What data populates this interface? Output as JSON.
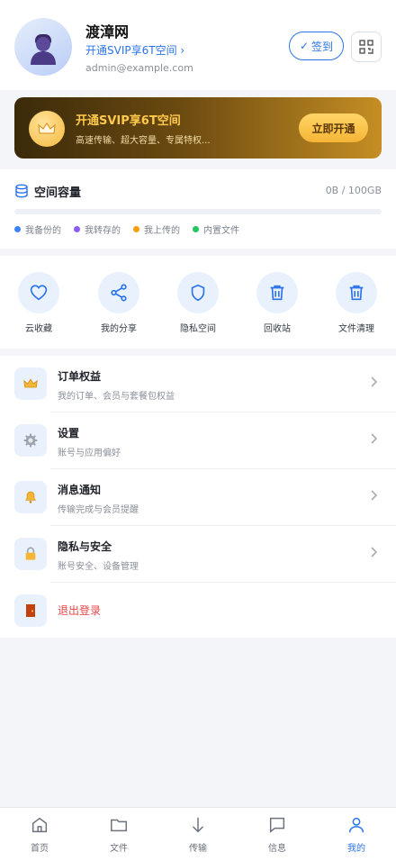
{
  "profile": {
    "name": "渡漳网",
    "vip_link": "开通SVIP享6T空间 ›",
    "email": "admin@example.com",
    "signin_label": "签到",
    "signin_check": "✓",
    "avatar_icon": "user-avatar-icon",
    "scan_icon": "qr-scan-icon"
  },
  "banner": {
    "title": "开通SVIP享6T空间",
    "subtitle": "高速传输、超大容量、专属特权...",
    "button": "立即开通",
    "icon": "crown-icon"
  },
  "storage": {
    "title": "空间容量",
    "usage": "0B / 100GB",
    "used_fraction": 0,
    "legend": [
      {
        "label": "我备份的",
        "color": "#3b82f6"
      },
      {
        "label": "我转存的",
        "color": "#8b5cf6"
      },
      {
        "label": "我上传的",
        "color": "#f59e0b"
      },
      {
        "label": "内置文件",
        "color": "#22c55e"
      }
    ]
  },
  "actions": [
    {
      "label": "云收藏",
      "icon": "heart-icon"
    },
    {
      "label": "我的分享",
      "icon": "share-icon"
    },
    {
      "label": "隐私空间",
      "icon": "shield-icon"
    },
    {
      "label": "回收站",
      "icon": "trash-icon"
    },
    {
      "label": "文件清理",
      "icon": "trash-clean-icon"
    }
  ],
  "menu": [
    {
      "title": "订单权益",
      "subtitle": "我的订单、会员与套餐包权益",
      "icon": "crown-icon"
    },
    {
      "title": "设置",
      "subtitle": "账号与应用偏好",
      "icon": "gear-icon"
    },
    {
      "title": "消息通知",
      "subtitle": "传输完成与会员提醒",
      "icon": "bell-icon"
    },
    {
      "title": "隐私与安全",
      "subtitle": "账号安全、设备管理",
      "icon": "lock-icon"
    }
  ],
  "logout": {
    "label": "退出登录",
    "icon": "door-icon"
  },
  "tabs": [
    {
      "label": "首页",
      "icon": "home-icon"
    },
    {
      "label": "文件",
      "icon": "folder-icon"
    },
    {
      "label": "传输",
      "icon": "download-arrow-icon"
    },
    {
      "label": "信息",
      "icon": "message-icon"
    },
    {
      "label": "我的",
      "icon": "user-icon",
      "active": true
    }
  ],
  "colors": {
    "accent": "#2b74e8",
    "danger": "#e84545",
    "gold": "#ffc94d"
  }
}
